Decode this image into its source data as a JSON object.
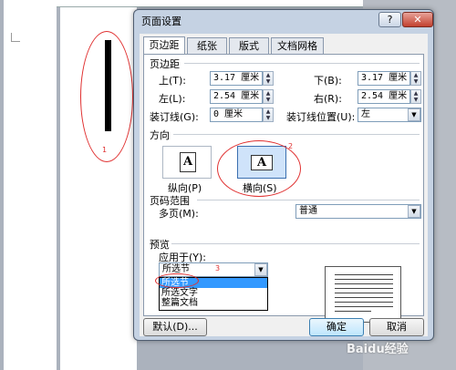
{
  "dialog": {
    "title": "页面设置",
    "help": "?",
    "close": "✕",
    "tabs": [
      "页边距",
      "纸张",
      "版式",
      "文档网格"
    ],
    "margins": {
      "section": "页边距",
      "top_label": "上(T):",
      "top_value": "3.17 厘米",
      "bottom_label": "下(B):",
      "bottom_value": "3.17 厘米",
      "left_label": "左(L):",
      "left_value": "2.54 厘米",
      "right_label": "右(R):",
      "right_value": "2.54 厘米",
      "gutter_label": "装订线(G):",
      "gutter_value": "0 厘米",
      "gutter_pos_label": "装订线位置(U):",
      "gutter_pos_value": "左"
    },
    "orientation": {
      "section": "方向",
      "portrait": "纵向(P)",
      "landscape": "横向(S)",
      "selected": "landscape",
      "glyph": "A"
    },
    "pages": {
      "section": "页码范围",
      "multiple_label": "多页(M):",
      "multiple_value": "普通"
    },
    "preview": {
      "section": "预览",
      "apply_label": "应用于(Y):",
      "apply_value": "所选节",
      "options": [
        "所选节",
        "所选文字",
        "整篇文档"
      ],
      "highlighted": 0
    },
    "buttons": {
      "default": "默认(D)...",
      "ok": "确定",
      "cancel": "取消"
    }
  },
  "annotations": [
    "1",
    "2",
    "3"
  ],
  "watermark": "Baidu经验"
}
